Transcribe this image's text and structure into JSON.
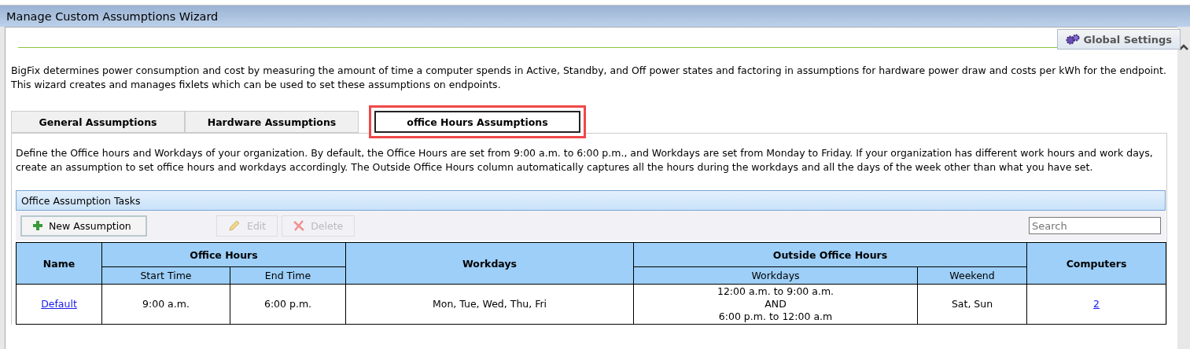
{
  "window": {
    "title": "Manage Custom Assumptions Wizard"
  },
  "global_settings": {
    "label": "Global Settings"
  },
  "intro": "BigFix determines power consumption and cost by measuring the amount of time a computer spends in Active, Standby, and Off power states and factoring in assumptions for hardware power draw and costs per kWh for the endpoint. This wizard creates and manages fixlets which can be used to set these assumptions on endpoints.",
  "tabs": [
    {
      "label": "General Assumptions",
      "selected": false
    },
    {
      "label": "Hardware Assumptions",
      "selected": false
    },
    {
      "label": "office Hours Assumptions",
      "selected": true
    }
  ],
  "description": "Define the Office hours and Workdays of your organization. By default, the Office Hours are set from 9:00 a.m. to 6:00 p.m., and Workdays are set from Monday to Friday. If your organization has different work hours and work days, create an assumption to set office hours and workdays accordingly. The Outside Office Hours column automatically captures all the hours during the workdays and all the days of the week other than what you have set.",
  "panel": {
    "title": "Office Assumption Tasks"
  },
  "toolbar": [
    {
      "kind": "add",
      "label": "New Assumption",
      "disabled": false
    },
    {
      "kind": "edit",
      "label": "Edit",
      "disabled": true
    },
    {
      "kind": "delete",
      "label": "Delete",
      "disabled": true
    }
  ],
  "search": {
    "placeholder": "Search"
  },
  "table": {
    "groups": [
      {
        "label": "Name"
      },
      {
        "label": "Office Hours",
        "subcolumns": [
          "Start Time",
          "End Time"
        ]
      },
      {
        "label": "Workdays"
      },
      {
        "label": "Outside Office Hours",
        "subcolumns": [
          "Workdays",
          "Weekend"
        ]
      },
      {
        "label": "Computers"
      }
    ],
    "rows": [
      [
        {
          "kind": "link",
          "lines": [
            "Default"
          ]
        },
        {
          "kind": "text",
          "lines": [
            "9:00 a.m."
          ]
        },
        {
          "kind": "text",
          "lines": [
            "6:00 p.m."
          ]
        },
        {
          "kind": "text",
          "lines": [
            "Mon, Tue, Wed, Thu, Fri"
          ]
        },
        {
          "kind": "text",
          "lines": [
            "12:00 a.m. to 9:00 a.m.",
            "AND",
            "6:00 p.m. to 12:00 a.m"
          ]
        },
        {
          "kind": "text",
          "lines": [
            "Sat, Sun"
          ]
        },
        {
          "kind": "link",
          "lines": [
            "2"
          ]
        }
      ]
    ]
  }
}
